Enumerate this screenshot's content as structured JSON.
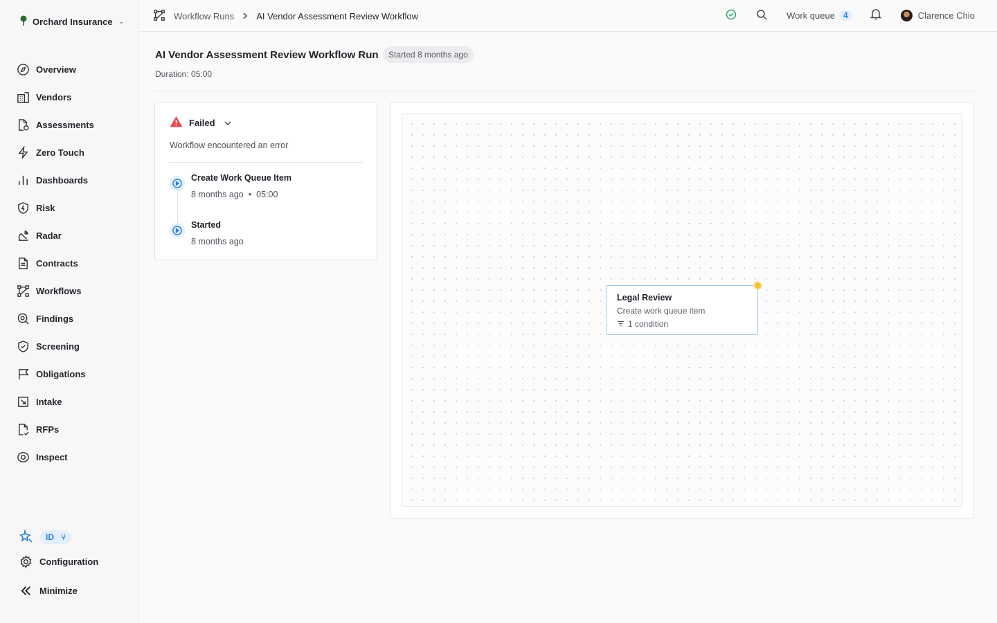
{
  "sidebar": {
    "org_name": "Orchard Insurance",
    "items": [
      {
        "label": "Overview",
        "icon": "compass-icon"
      },
      {
        "label": "Vendors",
        "icon": "building-icon"
      },
      {
        "label": "Assessments",
        "icon": "file-check-icon"
      },
      {
        "label": "Zero Touch",
        "icon": "bolt-icon"
      },
      {
        "label": "Dashboards",
        "icon": "bar-chart-icon"
      },
      {
        "label": "Risk",
        "icon": "shield-bolt-icon"
      },
      {
        "label": "Radar",
        "icon": "radar-icon"
      },
      {
        "label": "Contracts",
        "icon": "document-icon"
      },
      {
        "label": "Workflows",
        "icon": "workflow-icon"
      },
      {
        "label": "Findings",
        "icon": "search-doc-icon"
      },
      {
        "label": "Screening",
        "icon": "shield-check-icon"
      },
      {
        "label": "Obligations",
        "icon": "flag-icon"
      },
      {
        "label": "Intake",
        "icon": "inbox-arrow-icon"
      },
      {
        "label": "RFPs",
        "icon": "doc-check-icon"
      },
      {
        "label": "Inspect",
        "icon": "eye-icon"
      }
    ],
    "id_badge": "ID",
    "configuration_label": "Configuration",
    "minimize_label": "Minimize"
  },
  "topbar": {
    "breadcrumb_parent": "Workflow Runs",
    "breadcrumb_current": "AI Vendor Assessment Review Workflow",
    "work_queue_label": "Work queue",
    "work_queue_count": "4",
    "user_name": "Clarence Chio"
  },
  "page": {
    "title": "AI Vendor Assessment Review Workflow Run",
    "started_badge": "Started 8 months ago",
    "duration": "Duration: 05:00"
  },
  "status": {
    "label": "Failed",
    "message": "Workflow encountered an error",
    "timeline": [
      {
        "title": "Create Work Queue Item",
        "time": "8 months ago",
        "duration": "05:00"
      },
      {
        "title": "Started",
        "time": "8 months ago"
      }
    ]
  },
  "canvas": {
    "node": {
      "title": "Legal Review",
      "subtitle": "Create work queue item",
      "condition": "1 condition"
    }
  },
  "colors": {
    "accent": "#2f7fd6",
    "error": "#e5484d",
    "success": "#30a46c",
    "handle": "#f6c234"
  }
}
